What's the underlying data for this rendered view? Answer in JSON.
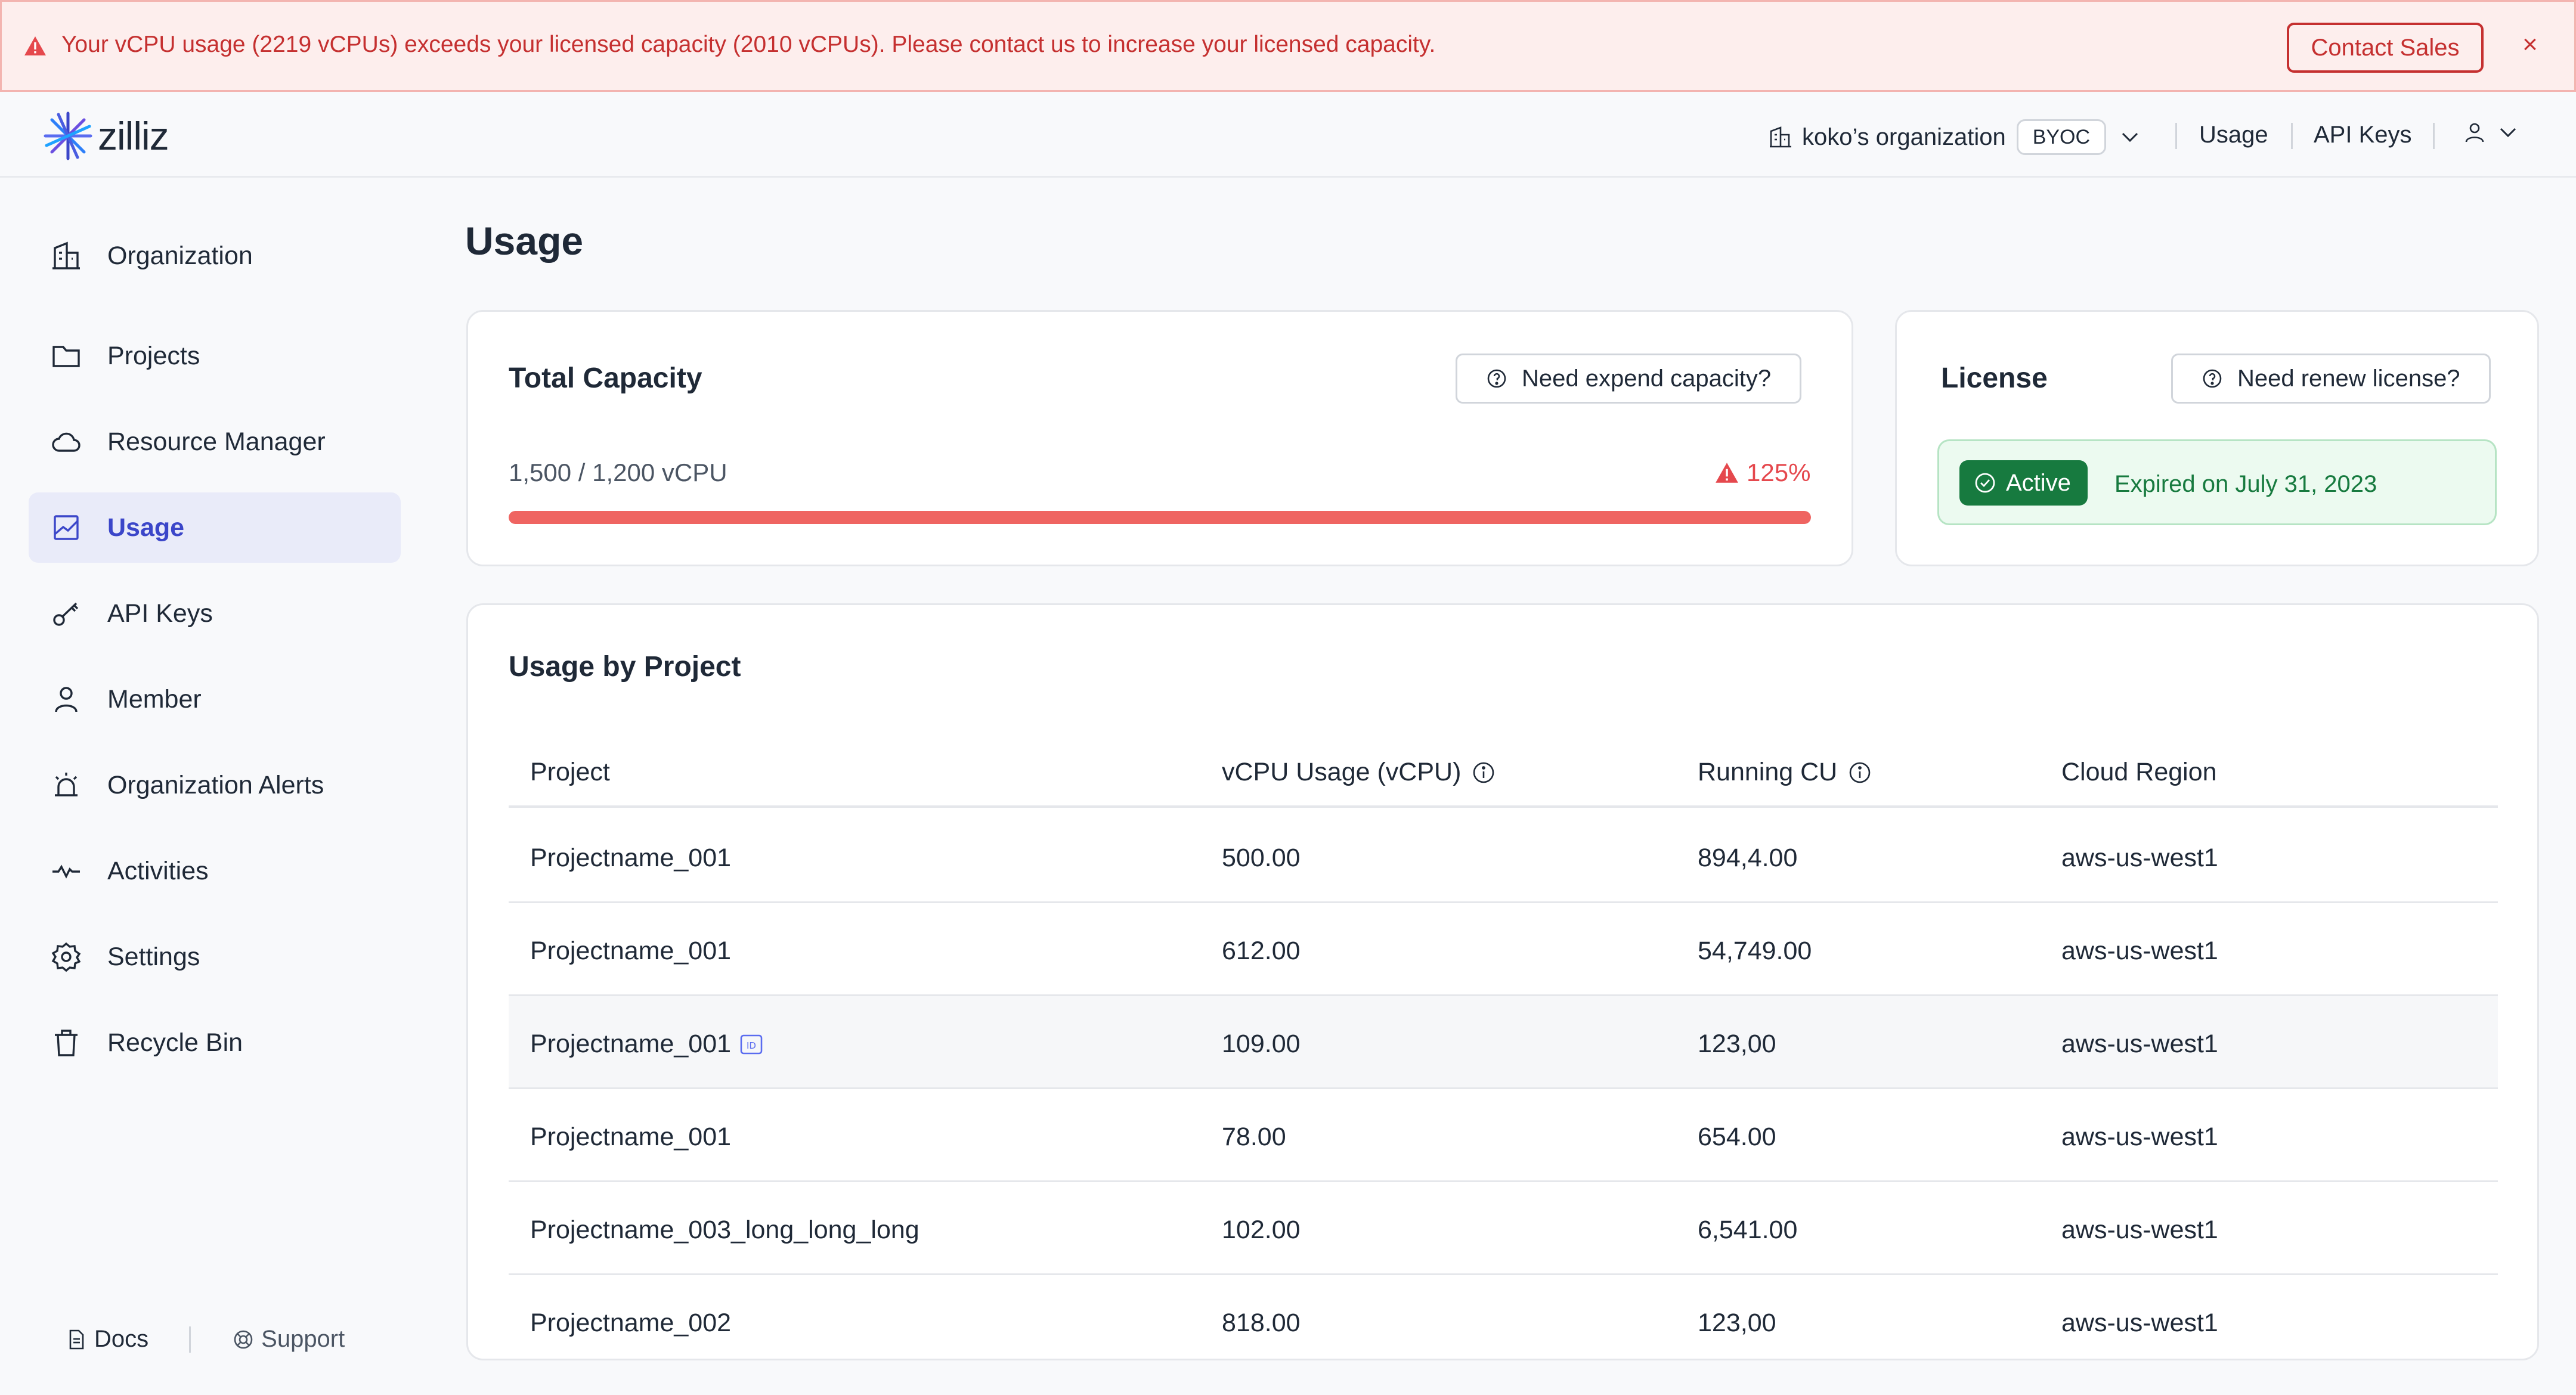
{
  "banner": {
    "message": "Your vCPU usage (2219 vCPUs) exceeds your licensed capacity (2010 vCPUs). Please contact us to increase your licensed capacity.",
    "contact_label": "Contact Sales",
    "close_glyph": "×",
    "color": "#c53030"
  },
  "header": {
    "logo_text": "zilliz",
    "org_name": "koko’s organization",
    "org_badge": "BYOC",
    "links": [
      "Usage",
      "API Keys"
    ]
  },
  "sidebar": {
    "items": [
      {
        "label": "Organization",
        "icon": "building-icon"
      },
      {
        "label": "Projects",
        "icon": "folder-icon"
      },
      {
        "label": "Resource Manager",
        "icon": "cloud-icon"
      },
      {
        "label": "Usage",
        "icon": "usage-icon",
        "active": true
      },
      {
        "label": "API Keys",
        "icon": "key-icon"
      },
      {
        "label": "Member",
        "icon": "user-icon"
      },
      {
        "label": "Organization Alerts",
        "icon": "alarm-icon"
      },
      {
        "label": "Activities",
        "icon": "pulse-icon"
      },
      {
        "label": "Settings",
        "icon": "gear-icon"
      },
      {
        "label": "Recycle Bin",
        "icon": "trash-icon"
      }
    ],
    "footer": {
      "docs": "Docs",
      "support": "Support"
    }
  },
  "main": {
    "title": "Usage",
    "capacity": {
      "title": "Total Capacity",
      "button": "Need expend capacity?",
      "value_text": "1,500 / 1,200  vCPU",
      "percent_text": "125%",
      "fill_fraction": 1.0,
      "bar_color": "#ef6461"
    },
    "license": {
      "title": "License",
      "button": "Need renew license?",
      "status": "Active",
      "expire_text": "Expired on July 31, 2023",
      "status_color": "#177a3f"
    },
    "usage_table": {
      "title": "Usage by Project",
      "columns": [
        "Project",
        "vCPU Usage (vCPU)",
        "Running CU",
        "Cloud Region"
      ],
      "rows": [
        {
          "project": "Projectname_001",
          "vcpu": "500.00",
          "cu": "894,4.00",
          "region": "aws-us-west1"
        },
        {
          "project": "Projectname_001",
          "vcpu": "612.00",
          "cu": "54,749.00",
          "region": "aws-us-west1"
        },
        {
          "project": "Projectname_001",
          "vcpu": "109.00",
          "cu": "123,00",
          "region": "aws-us-west1",
          "highlight": true,
          "id_tag": "ID"
        },
        {
          "project": "Projectname_001",
          "vcpu": "78.00",
          "cu": "654.00",
          "region": "aws-us-west1"
        },
        {
          "project": "Projectname_003_long_long_long",
          "vcpu": "102.00",
          "cu": "6,541.00",
          "region": "aws-us-west1"
        },
        {
          "project": "Projectname_002",
          "vcpu": "818.00",
          "cu": "123,00",
          "region": "aws-us-west1"
        }
      ]
    }
  }
}
